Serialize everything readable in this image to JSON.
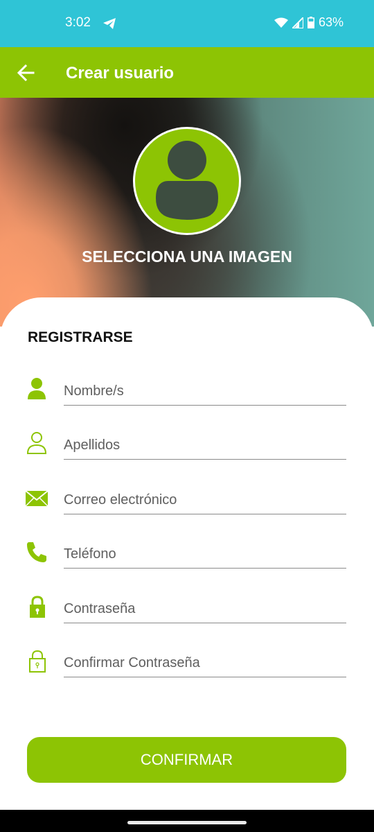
{
  "status_bar": {
    "time": "3:02",
    "battery_percent": "63%",
    "icons": [
      "telegram-icon",
      "wifi-icon",
      "signal-icon",
      "battery-icon"
    ]
  },
  "app_bar": {
    "title": "Crear usuario",
    "back_icon": "arrow-left-icon"
  },
  "hero": {
    "avatar_icon": "person-placeholder-icon",
    "select_image_label": "SELECCIONA UNA IMAGEN"
  },
  "form": {
    "title": "REGISTRARSE",
    "fields": [
      {
        "icon": "person-solid-icon",
        "placeholder": "Nombre/s",
        "value": ""
      },
      {
        "icon": "person-outline-icon",
        "placeholder": "Apellidos",
        "value": ""
      },
      {
        "icon": "envelope-icon",
        "placeholder": "Correo electrónico",
        "value": ""
      },
      {
        "icon": "phone-icon",
        "placeholder": "Teléfono",
        "value": ""
      },
      {
        "icon": "lock-solid-icon",
        "placeholder": "Contraseña",
        "value": ""
      },
      {
        "icon": "lock-outline-icon",
        "placeholder": "Confirmar Contraseña",
        "value": ""
      }
    ],
    "confirm_label": "CONFIRMAR"
  },
  "colors": {
    "status_bar": "#2fc4d6",
    "accent": "#8dc404",
    "background": "#ffffff"
  }
}
